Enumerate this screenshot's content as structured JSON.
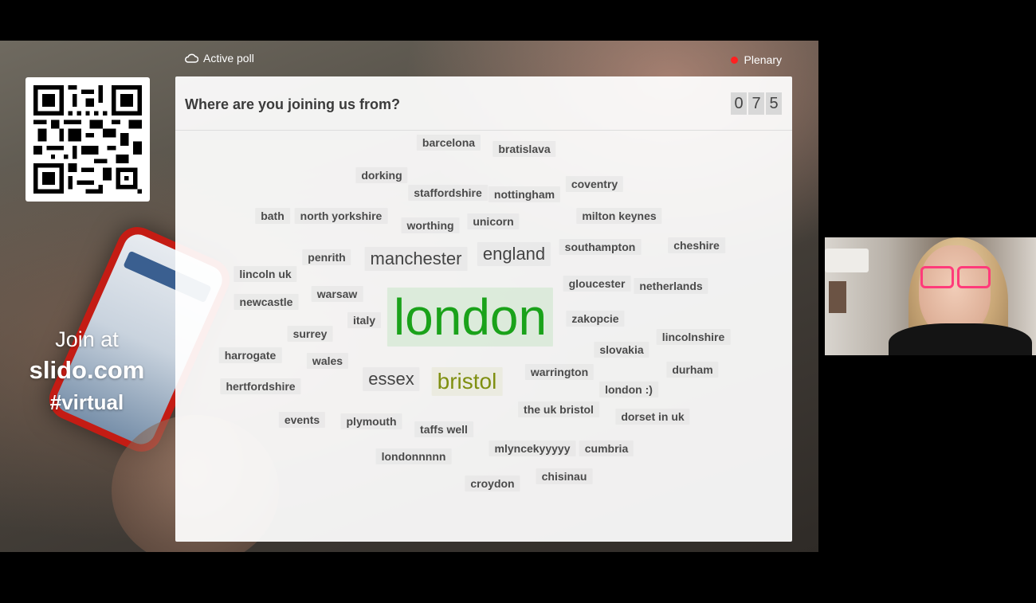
{
  "topbar": {
    "active_poll_label": "Active poll",
    "room_label": "Plenary"
  },
  "sidebar": {
    "join_line1": "Join at",
    "join_line2": "slido.com",
    "join_line3": "#virtual"
  },
  "poll": {
    "question": "Where are you joining us from?",
    "counter": [
      "0",
      "7",
      "5"
    ]
  },
  "words": {
    "barcelona": "barcelona",
    "bratislava": "bratislava",
    "dorking": "dorking",
    "staffordshire": "staffordshire",
    "nottingham": "nottingham",
    "coventry": "coventry",
    "bath": "bath",
    "north_yorkshire": "north yorkshire",
    "worthing": "worthing",
    "unicorn": "unicorn",
    "milton_keynes": "milton keynes",
    "penrith": "penrith",
    "manchester": "manchester",
    "england": "england",
    "southampton": "southampton",
    "cheshire": "cheshire",
    "lincoln_uk": "lincoln uk",
    "gloucester": "gloucester",
    "netherlands": "netherlands",
    "warsaw": "warsaw",
    "newcastle": "newcastle",
    "london": "london",
    "zakopcie": "zakopcie",
    "italy": "italy",
    "surrey": "surrey",
    "lincolnshire": "lincolnshire",
    "slovakia": "slovakia",
    "harrogate": "harrogate",
    "wales": "wales",
    "essex": "essex",
    "bristol": "bristol",
    "warrington": "warrington",
    "durham": "durham",
    "hertfordshire": "hertfordshire",
    "london_smile": "london :)",
    "events": "events",
    "plymouth": "plymouth",
    "the_uk_bristol": "the uk bristol",
    "dorset_in_uk": "dorset in uk",
    "taffs_well": "taffs well",
    "mlyncekyyyyy": "mlyncekyyyyy",
    "cumbria": "cumbria",
    "londonnnnn": "londonnnnn",
    "croydon": "croydon",
    "chisinau": "chisinau"
  },
  "colors": {
    "accent_green": "#1aa21a",
    "accent_olive": "#7f8f10",
    "live_red": "#ff2020"
  },
  "icons": {
    "poll": "cloud-icon",
    "live": "live-dot-icon",
    "cursor": "cursor-icon"
  }
}
